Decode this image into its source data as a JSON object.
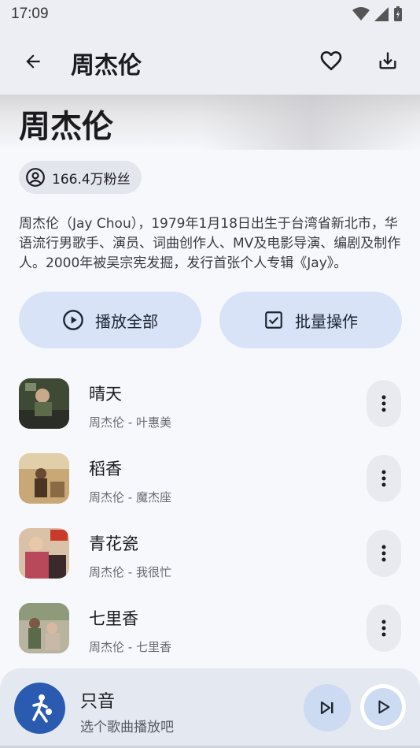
{
  "status_bar": {
    "time": "17:09"
  },
  "app_bar": {
    "title": "周杰伦"
  },
  "artist": {
    "name": "周杰伦",
    "fans": "166.4万粉丝",
    "bio": "周杰伦（Jay Chou），1979年1月18日出生于台湾省新北市，华语流行男歌手、演员、词曲创作人、MV及电影导演、编剧及制作人。2000年被吴宗宪发掘，发行首张个人专辑《Jay》。"
  },
  "actions": {
    "play_all": "播放全部",
    "batch": "批量操作"
  },
  "songs": [
    {
      "title": "晴天",
      "subtitle": "周杰伦 - 叶惠美",
      "cover_color": "#4a5a3c"
    },
    {
      "title": "稻香",
      "subtitle": "周杰伦 - 魔杰座",
      "cover_color": "#8a6a44"
    },
    {
      "title": "青花瓷",
      "subtitle": "周杰伦 - 我很忙",
      "cover_color": "#b04a5a"
    },
    {
      "title": "七里香",
      "subtitle": "周杰伦 - 七里香",
      "cover_color": "#6b7a5a"
    }
  ],
  "mini_player": {
    "title": "只音",
    "subtitle": "选个歌曲播放吧"
  },
  "colors": {
    "accent": "#2a5bb0",
    "chip": "#d8e3f7"
  }
}
